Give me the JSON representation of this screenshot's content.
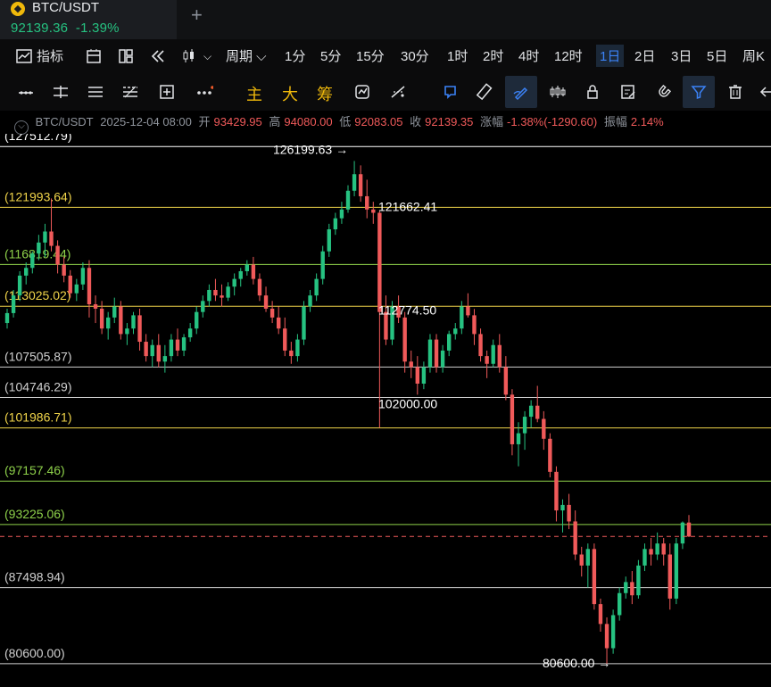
{
  "header": {
    "symbol": "BTC/USDT",
    "last_price": "92139.36",
    "change_pct": "-1.39%",
    "logo_icon": "binance-coin-icon",
    "add_tab_icon": "plus-icon"
  },
  "toolbar": {
    "indicators_label": "指标",
    "period_label": "周期",
    "intervals": [
      "1分",
      "5分",
      "15分",
      "30分",
      "1时",
      "2时",
      "4时",
      "12时",
      "1日",
      "2日",
      "3日",
      "5日",
      "周K"
    ],
    "active_interval": "1日"
  },
  "drawing_tools": {
    "main_label": "主",
    "big_label": "大",
    "chip_label": "筹"
  },
  "ohlc_bar": {
    "symbol": "BTC/USDT",
    "datetime": "2025-12-04 08:00",
    "open_label": "开",
    "open": "93429.95",
    "high_label": "高",
    "high": "94080.00",
    "low_label": "低",
    "low": "92083.05",
    "close_label": "收",
    "close": "92139.35",
    "change_label": "涨幅",
    "change": "-1.38%(-1290.60)",
    "amplitude_label": "振幅",
    "amplitude": "2.14%"
  },
  "levels": [
    {
      "label": "(127512.79)",
      "value": 127512.79,
      "color": "#ffffff"
    },
    {
      "label": "(121993.64)",
      "value": 121993.64,
      "color": "#f0d44a"
    },
    {
      "label": "(116819.44)",
      "value": 116819.44,
      "color": "#8ed14a"
    },
    {
      "label": "(113025.02)",
      "value": 113025.02,
      "color": "#f0d44a"
    },
    {
      "label": "(107505.87)",
      "value": 107505.87,
      "color": "#d0d0d0"
    },
    {
      "label": "(104746.29)",
      "value": 104746.29,
      "color": "#d0d0d0"
    },
    {
      "label": "(101986.71)",
      "value": 101986.71,
      "color": "#f0d44a"
    },
    {
      "label": "(97157.46)",
      "value": 97157.46,
      "color": "#8ed14a"
    },
    {
      "label": "(93225.06)",
      "value": 93225.06,
      "color": "#8ed14a"
    },
    {
      "label": "(87498.94)",
      "value": 87498.94,
      "color": "#d0d0d0"
    },
    {
      "label": "(80600.00)",
      "value": 80600.0,
      "color": "#d0d0d0"
    }
  ],
  "annotations": [
    {
      "text": "126199.63 →",
      "value": 126199.63
    },
    {
      "text": "121662.41",
      "value": 121662.41
    },
    {
      "text": "112774.50",
      "value": 112774.5
    },
    {
      "text": "102000.00",
      "value": 102000.0
    },
    {
      "text": "80600.00 →",
      "value": 80600.0
    }
  ],
  "chart_data": {
    "type": "candlestick",
    "ylim": [
      80100,
      128500
    ],
    "current_price": 92139.35,
    "colors": {
      "up": "#26c281",
      "down": "#f05a5a"
    },
    "candles": [
      [
        111500,
        112800,
        111000,
        112400
      ],
      [
        112400,
        114500,
        112000,
        114000
      ],
      [
        114000,
        116200,
        113500,
        115800
      ],
      [
        115800,
        117000,
        115000,
        116500
      ],
      [
        116500,
        118000,
        116000,
        117800
      ],
      [
        117800,
        119500,
        117200,
        118800
      ],
      [
        118800,
        120500,
        117500,
        119800
      ],
      [
        119800,
        122800,
        118000,
        118500
      ],
      [
        118500,
        119000,
        116000,
        116800
      ],
      [
        116800,
        117500,
        115200,
        115800
      ],
      [
        115800,
        116300,
        113800,
        114200
      ],
      [
        114200,
        115500,
        113500,
        115000
      ],
      [
        115000,
        117000,
        114500,
        116500
      ],
      [
        116500,
        117200,
        112000,
        113200
      ],
      [
        113200,
        114000,
        111500,
        112800
      ],
      [
        112800,
        113500,
        110500,
        111000
      ],
      [
        111000,
        112500,
        110000,
        112000
      ],
      [
        112000,
        113800,
        111500,
        113000
      ],
      [
        113000,
        113500,
        110000,
        110500
      ],
      [
        110500,
        111500,
        109500,
        111000
      ],
      [
        111000,
        112500,
        110500,
        112200
      ],
      [
        112200,
        112800,
        109000,
        109800
      ],
      [
        109800,
        110500,
        108000,
        108500
      ],
      [
        108500,
        110000,
        107500,
        109500
      ],
      [
        109500,
        110500,
        107500,
        108000
      ],
      [
        108000,
        109500,
        107000,
        108500
      ],
      [
        108500,
        110500,
        108000,
        110000
      ],
      [
        110000,
        111000,
        108500,
        109000
      ],
      [
        109000,
        110500,
        108500,
        110200
      ],
      [
        110200,
        111500,
        109800,
        111000
      ],
      [
        111000,
        113000,
        110500,
        112500
      ],
      [
        112500,
        114000,
        112000,
        113500
      ],
      [
        113500,
        115000,
        113000,
        114500
      ],
      [
        114500,
        115500,
        113500,
        114000
      ],
      [
        114000,
        115000,
        113000,
        113800
      ],
      [
        113800,
        115200,
        113500,
        114800
      ],
      [
        114800,
        116000,
        114000,
        115500
      ],
      [
        115500,
        116500,
        114800,
        116200
      ],
      [
        116200,
        117200,
        115800,
        116800
      ],
      [
        116800,
        117500,
        115000,
        115500
      ],
      [
        115500,
        116000,
        113500,
        114000
      ],
      [
        114000,
        114800,
        112500,
        112800
      ],
      [
        112800,
        113500,
        111500,
        112000
      ],
      [
        112000,
        113000,
        110500,
        111000
      ],
      [
        111000,
        112000,
        108500,
        109000
      ],
      [
        109000,
        109800,
        107800,
        108500
      ],
      [
        108500,
        110500,
        108000,
        110000
      ],
      [
        110000,
        113500,
        109500,
        113000
      ],
      [
        113000,
        114500,
        112500,
        114000
      ],
      [
        114000,
        116000,
        113500,
        115500
      ],
      [
        115500,
        118500,
        115000,
        118000
      ],
      [
        118000,
        120500,
        117500,
        120000
      ],
      [
        120000,
        121500,
        119500,
        121000
      ],
      [
        121000,
        122500,
        120500,
        121800
      ],
      [
        121800,
        124000,
        121500,
        123500
      ],
      [
        123500,
        126199,
        123000,
        125000
      ],
      [
        125000,
        125800,
        122500,
        123000
      ],
      [
        123000,
        124500,
        121000,
        121800
      ],
      [
        121800,
        122500,
        120500,
        121500
      ],
      [
        121500,
        121662,
        101990,
        112500
      ],
      [
        112500,
        114000,
        109500,
        110000
      ],
      [
        110000,
        113500,
        109500,
        113000
      ],
      [
        113000,
        114000,
        111500,
        112000
      ],
      [
        112000,
        112500,
        107000,
        108000
      ],
      [
        108000,
        109000,
        106500,
        107500
      ],
      [
        107500,
        108500,
        105000,
        106000
      ],
      [
        106000,
        108000,
        105500,
        107500
      ],
      [
        107500,
        110500,
        107000,
        110000
      ],
      [
        110000,
        110500,
        107000,
        107500
      ],
      [
        107500,
        109500,
        107000,
        109000
      ],
      [
        109000,
        110800,
        108500,
        110500
      ],
      [
        110500,
        111500,
        110000,
        111000
      ],
      [
        111000,
        113500,
        110500,
        113000
      ],
      [
        113000,
        114200,
        112000,
        112200
      ],
      [
        112200,
        112774,
        109500,
        110500
      ],
      [
        110500,
        111000,
        108000,
        108500
      ],
      [
        108500,
        109000,
        106500,
        107800
      ],
      [
        107800,
        110000,
        107500,
        109500
      ],
      [
        109500,
        110500,
        107000,
        107500
      ],
      [
        107500,
        108500,
        104500,
        105000
      ],
      [
        105000,
        105500,
        99500,
        100500
      ],
      [
        100500,
        102500,
        98500,
        101500
      ],
      [
        101500,
        103500,
        100000,
        103000
      ],
      [
        103000,
        104500,
        102000,
        104000
      ],
      [
        104000,
        105800,
        102500,
        102800
      ],
      [
        102800,
        103500,
        100000,
        101000
      ],
      [
        101000,
        101500,
        97500,
        98000
      ],
      [
        98000,
        98500,
        93500,
        94500
      ],
      [
        94500,
        95500,
        92500,
        95000
      ],
      [
        95000,
        96000,
        92800,
        93500
      ],
      [
        93500,
        94500,
        90000,
        90500
      ],
      [
        90500,
        91200,
        88500,
        89500
      ],
      [
        89500,
        91500,
        87500,
        91000
      ],
      [
        91000,
        91500,
        85500,
        86000
      ],
      [
        86000,
        86500,
        83500,
        84200
      ],
      [
        84200,
        84800,
        80600,
        82000
      ],
      [
        82000,
        85500,
        81500,
        85000
      ],
      [
        85000,
        87500,
        84500,
        87000
      ],
      [
        87000,
        88500,
        86500,
        88000
      ],
      [
        88000,
        89000,
        86000,
        86800
      ],
      [
        86800,
        90000,
        86500,
        89500
      ],
      [
        89500,
        91500,
        89000,
        91000
      ],
      [
        91000,
        92000,
        89500,
        90500
      ],
      [
        90500,
        92500,
        90000,
        91500
      ],
      [
        91500,
        92000,
        89500,
        90500
      ],
      [
        90500,
        91500,
        85500,
        86500
      ],
      [
        86500,
        92000,
        86000,
        91500
      ],
      [
        91500,
        93500,
        91000,
        93400
      ],
      [
        93400,
        94080,
        92083,
        92139
      ]
    ]
  }
}
